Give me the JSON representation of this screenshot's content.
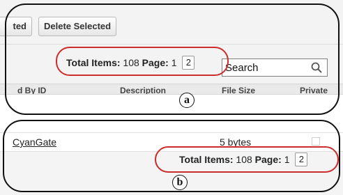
{
  "panel_a": {
    "toolbar": {
      "partial_button_label": "ted",
      "delete_selected_label": "Delete Selected"
    },
    "pager": {
      "total_items_label": "Total Items:",
      "total_items_value": "108",
      "page_label": "Page:",
      "current_page": "1",
      "page_link": "2"
    },
    "search": {
      "placeholder": "Search"
    },
    "columns": [
      "d By ID",
      "Description",
      "File Size",
      "Private"
    ],
    "marker_label": "a"
  },
  "panel_b": {
    "row": {
      "name": "CyanGate",
      "file_size": "5 bytes"
    },
    "pager": {
      "total_items_label": "Total Items:",
      "total_items_value": "108",
      "page_label": "Page:",
      "current_page": "1",
      "page_link": "2"
    },
    "marker_label": "b"
  },
  "colors": {
    "highlight": "#cc2b2b",
    "frame": "#111111",
    "toolbar_bg": "#f3f3f3"
  }
}
